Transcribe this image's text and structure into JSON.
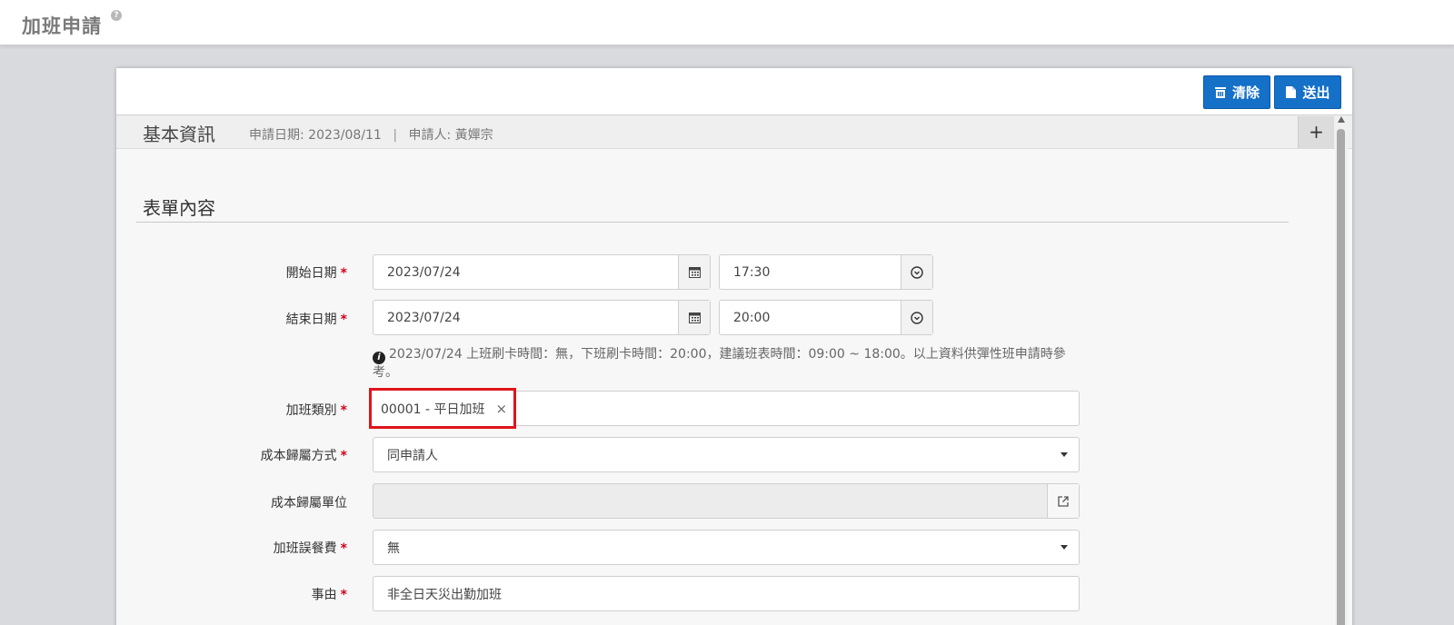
{
  "page": {
    "title": "加班申請",
    "help_icon": "?"
  },
  "toolbar": {
    "clear_label": "清除",
    "submit_label": "送出",
    "clear_icon": "trash-icon",
    "submit_icon": "document-icon",
    "accent_color": "#1570c8"
  },
  "basic_info": {
    "title": "基本資訊",
    "apply_date": "申請日期: 2023/08/11",
    "separator": "|",
    "applicant": "申請人: 黃嬋宗",
    "collapse_icon": "+"
  },
  "form": {
    "title": "表單內容",
    "required_mark": "*",
    "start": {
      "label": "開始日期",
      "date": "2023/07/24",
      "time": "17:30"
    },
    "end": {
      "label": "結束日期",
      "date": "2023/07/24",
      "time": "20:00"
    },
    "hint": "2023/07/24 上班刷卡時間：無，下班刷卡時間：20:00，建議班表時間：09:00 ~ 18:00。以上資料供彈性班申請時參考。",
    "overtime_type": {
      "label": "加班類別",
      "selected_tag": "00001 - 平日加班",
      "remove_symbol": "×"
    },
    "cost_method": {
      "label": "成本歸屬方式",
      "value": "同申請人"
    },
    "cost_unit": {
      "label": "成本歸屬單位",
      "value": ""
    },
    "meal_fee": {
      "label": "加班誤餐費",
      "value": "無"
    },
    "reason": {
      "label": "事由",
      "value": "非全日天災出勤加班"
    }
  }
}
